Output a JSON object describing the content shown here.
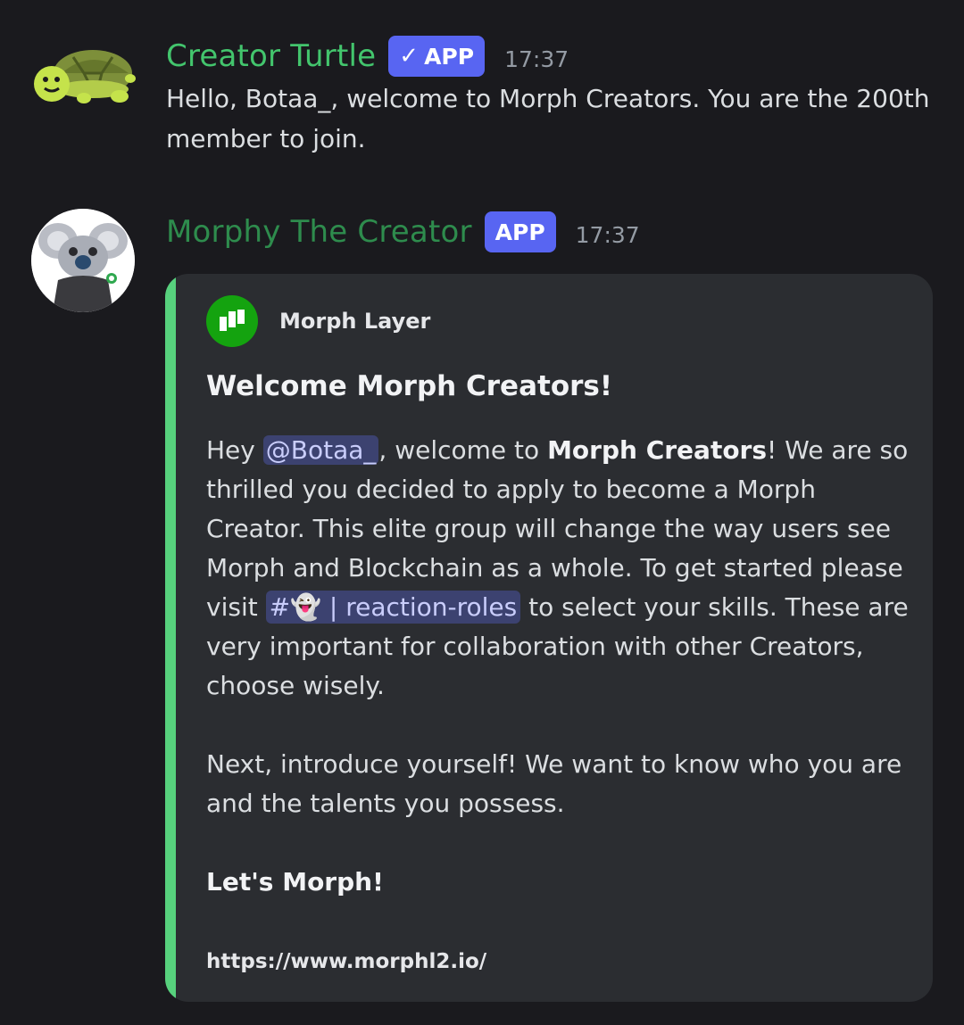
{
  "messages": [
    {
      "username": "Creator Turtle",
      "username_color": "#43c56d",
      "badge": "APP",
      "badge_verified": true,
      "timestamp": "17:37",
      "text": "Hello, Botaa_, welcome to Morph Creators. You are the 200th member to join.",
      "avatar_icon": "turtle-avatar"
    },
    {
      "username": "Morphy The Creator",
      "username_color": "#2e8c4d",
      "badge": "APP",
      "badge_verified": false,
      "timestamp": "17:37",
      "avatar_icon": "koala-avatar",
      "embed": {
        "accent_color": "#57d17d",
        "author": "Morph Layer",
        "title": "Welcome Morph Creators!",
        "desc": {
          "p1_hey": "Hey ",
          "mention": "@Botaa_",
          "p1_welcome": ", welcome to ",
          "p1_bold": "Morph Creators",
          "p1_rest": "! We are so thrilled you decided to apply to become a Morph Creator. This elite group will change the way users see Morph and Blockchain as a whole. To get started please visit ",
          "channel_hash": "#",
          "channel_emoji": "👻",
          "channel_sep": "|",
          "channel_name": "reaction-roles",
          "p1_end": " to select your skills. These are very important for collaboration with other Creators, choose wisely.",
          "p2": "Next, introduce yourself! We want to know who you are and the talents you possess.",
          "p3": "Let's Morph!"
        },
        "url": "https://www.morphl2.io/"
      }
    }
  ],
  "colors": {
    "background": "#1a1a1e",
    "embed_bg": "#2b2d31",
    "badge_bg": "#5865f2",
    "mention_bg": "#3c4270",
    "mention_fg": "#c9cdfb"
  }
}
